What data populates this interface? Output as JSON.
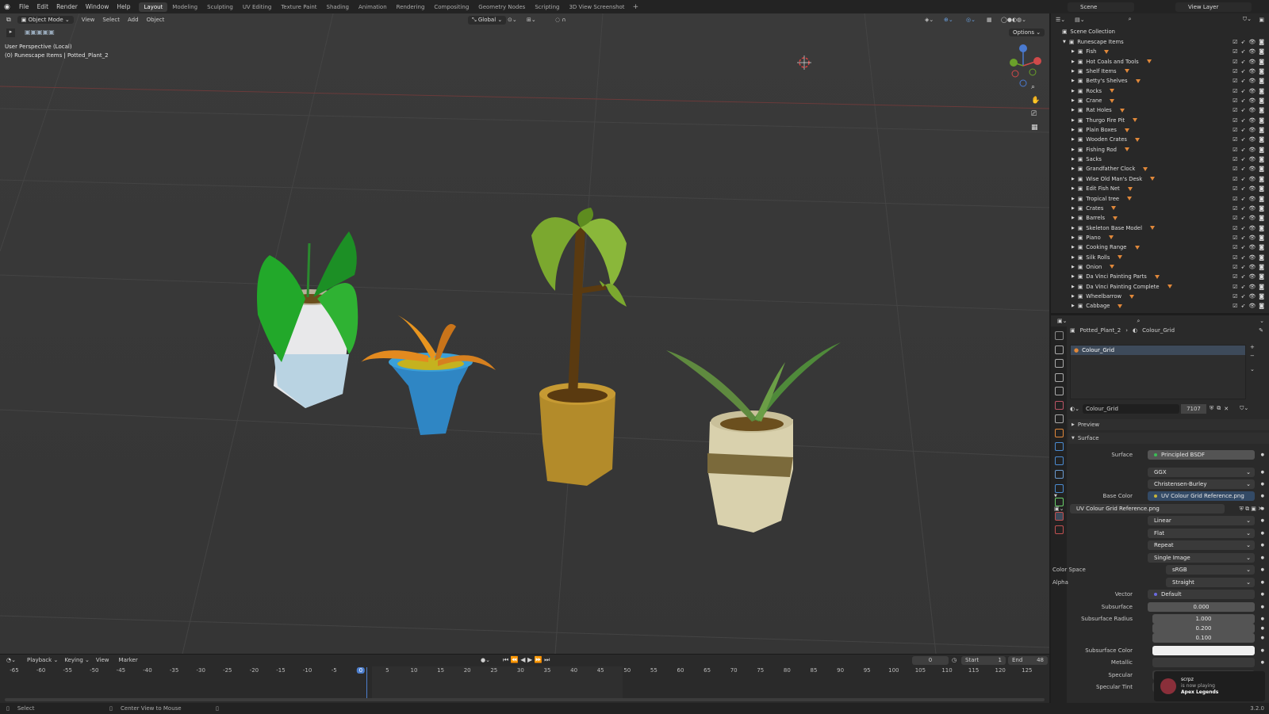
{
  "menu": [
    "File",
    "Edit",
    "Render",
    "Window",
    "Help"
  ],
  "workspaces": [
    "Layout",
    "Modeling",
    "Sculpting",
    "UV Editing",
    "Texture Paint",
    "Shading",
    "Animation",
    "Rendering",
    "Compositing",
    "Geometry Nodes",
    "Scripting",
    "3D View Screenshot"
  ],
  "scene": "Scene",
  "view_layer": "View Layer",
  "viewport": {
    "mode": "Object Mode",
    "menus": [
      "View",
      "Select",
      "Add",
      "Object"
    ],
    "transform": "Global",
    "options": "Options",
    "perspective": "User Perspective (Local)",
    "context": "(0) Runescape Items | Potted_Plant_2"
  },
  "outliner": {
    "root": "Scene Collection",
    "collection": "Runescape Items",
    "items": [
      "Fish",
      "Hot Coals and Tools",
      "Shelf Items",
      "Betty's Shelves",
      "Rocks",
      "Crane",
      "Rat Holes",
      "Thurgo Fire Pit",
      "Plain Boxes",
      "Wooden Crates",
      "Fishing Rod",
      "Sacks",
      "Grandfather Clock",
      "Wise Old Man's Desk",
      "Edit Fish Net",
      "Tropical tree",
      "Crates",
      "Barrels",
      "Skeleton Base Model",
      "Piano",
      "Cooking Range",
      "Silk Rolls",
      "Onion",
      "Da Vinci Painting Parts",
      "Da Vinci Painting Complete",
      "Wheelbarrow",
      "Cabbage"
    ]
  },
  "properties": {
    "breadcrumb_object": "Potted_Plant_2",
    "breadcrumb_material": "Colour_Grid",
    "slot": "Colour_Grid",
    "material_name": "Colour_Grid",
    "users": "7107",
    "preview": "Preview",
    "surface_header": "Surface",
    "surface_label": "Surface",
    "surface_value": "Principled BSDF",
    "distribution": "GGX",
    "subsurface_method": "Christensen-Burley",
    "base_color_label": "Base Color",
    "base_color_value": "UV Colour Grid Reference.png",
    "image_name": "UV Colour Grid Reference.png",
    "interpolation": "Linear",
    "projection": "Flat",
    "extension": "Repeat",
    "source": "Single Image",
    "color_space_label": "Color Space",
    "color_space": "sRGB",
    "alpha_label": "Alpha",
    "alpha": "Straight",
    "vector_label": "Vector",
    "vector": "Default",
    "subsurface_label": "Subsurface",
    "subsurface": "0.000",
    "subsurface_radius_label": "Subsurface Radius",
    "subsurface_radius": [
      "1.000",
      "0.200",
      "0.100"
    ],
    "subsurface_color_label": "Subsurface Color",
    "metallic_label": "Metallic",
    "specular_label": "Specular",
    "specular_tint_label": "Specular Tint"
  },
  "timeline": {
    "menus": [
      "Playback",
      "Keying",
      "View",
      "Marker"
    ],
    "current_frame": "0",
    "start_label": "Start",
    "start": "1",
    "end_label": "End",
    "end": "48",
    "ticks": [
      "-65",
      "-60",
      "-55",
      "-50",
      "-45",
      "-40",
      "-35",
      "-30",
      "-25",
      "-20",
      "-15",
      "-10",
      "-5",
      "0",
      "5",
      "10",
      "15",
      "20",
      "25",
      "30",
      "35",
      "40",
      "45",
      "50",
      "55",
      "60",
      "65",
      "70",
      "75",
      "80",
      "85",
      "90",
      "95",
      "100",
      "105",
      "110",
      "115",
      "120",
      "125"
    ]
  },
  "status": {
    "select": "Select",
    "center": "Center View to Mouse",
    "version": "3.2.0"
  },
  "notification": {
    "user": "scrpz",
    "line": "is now playing",
    "game": "Apex Legends"
  }
}
